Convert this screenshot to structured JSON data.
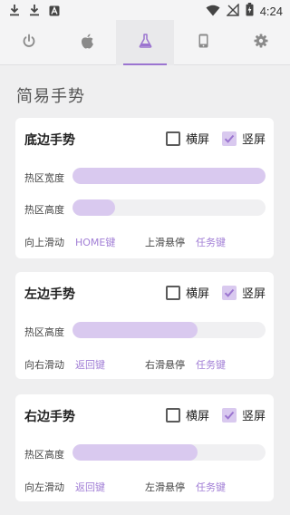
{
  "status_bar": {
    "time": "4:24",
    "icons": [
      "download-icon",
      "download-icon",
      "app-badge-icon",
      "wifi-icon",
      "no-signal-icon",
      "battery-charging-icon"
    ]
  },
  "tabs": [
    {
      "name": "power",
      "icon": "power-icon"
    },
    {
      "name": "apple",
      "icon": "apple-icon"
    },
    {
      "name": "flask",
      "icon": "flask-icon",
      "active": true
    },
    {
      "name": "phone",
      "icon": "phone-icon"
    },
    {
      "name": "settings",
      "icon": "gear-icon"
    }
  ],
  "accent_color": "#a27fd6",
  "section_title": "简易手势",
  "cards": [
    {
      "title": "底边手势",
      "landscape_label": "横屏",
      "landscape_checked": false,
      "portrait_label": "竖屏",
      "portrait_checked": true,
      "width_label": "热区宽度",
      "width_value": 1.0,
      "height_label": "热区高度",
      "height_value": 0.22,
      "swipe_label": "向上滑动",
      "swipe_value": "HOME键",
      "hover_label": "上滑悬停",
      "hover_value": "任务键"
    },
    {
      "title": "左边手势",
      "landscape_label": "横屏",
      "landscape_checked": false,
      "portrait_label": "竖屏",
      "portrait_checked": true,
      "height_label": "热区高度",
      "height_value": 0.65,
      "swipe_label": "向右滑动",
      "swipe_value": "返回键",
      "hover_label": "右滑悬停",
      "hover_value": "任务键"
    },
    {
      "title": "右边手势",
      "landscape_label": "横屏",
      "landscape_checked": false,
      "portrait_label": "竖屏",
      "portrait_checked": true,
      "height_label": "热区高度",
      "height_value": 0.65,
      "swipe_label": "向左滑动",
      "swipe_value": "返回键",
      "hover_label": "左滑悬停",
      "hover_value": "任务键"
    }
  ]
}
